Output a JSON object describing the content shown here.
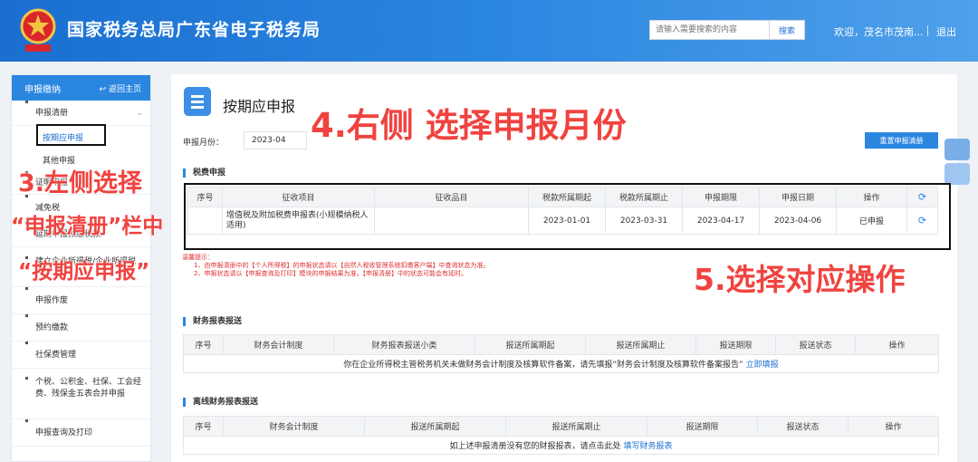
{
  "header": {
    "site_title": "国家税务总局广东省电子税务局",
    "search_placeholder": "请输入需要搜索的内容",
    "search_button": "搜索",
    "welcome": "欢迎，茂名市茂南...",
    "logout": "退出"
  },
  "sidebar": {
    "title": "申报缴纳",
    "back_home": "返回主页",
    "items": [
      {
        "label": "申报清册"
      },
      {
        "label": "按期应申报"
      },
      {
        "label": "其他申报"
      },
      {
        "label": "证明申报"
      },
      {
        "label": "减免税"
      },
      {
        "label": "延期申报预缴税款"
      },
      {
        "label": "建立企业所得税/企业所得税"
      },
      {
        "label": "申报作废"
      },
      {
        "label": "预约缴款"
      },
      {
        "label": "社保费管理"
      },
      {
        "label": "个税、公积金、社保、工会经费、残保金五表合并申报"
      },
      {
        "label": "申报查询及打印"
      }
    ]
  },
  "main": {
    "page_title": "按期应申报",
    "month_label": "申报月份：",
    "month_value": "2023-04",
    "reset_button": "重置申报清册",
    "tax_section": {
      "title": "税费申报",
      "headers": [
        "序号",
        "征收项目",
        "征收品目",
        "税款所属期起",
        "税款所属期止",
        "申报期限",
        "申报日期",
        "操作"
      ],
      "rows": [
        {
          "no": "",
          "item": "增值税及附加税费申报表(小规模纳税人适用)",
          "sub": "",
          "start": "2023-01-01",
          "end": "2023-03-31",
          "deadline": "2023-04-17",
          "date": "2023-04-06",
          "status": "已申报"
        }
      ]
    },
    "tips": {
      "lead": "温馨提示：",
      "line1": "1、由申报清册中的【个人所得税】的申报状态请以【自然人税收管理系统扣缴客户端】中查询状态为准。",
      "line2": "2、申报状态请以【申报查询及打印】模块的申报结果为准，【申报清册】中的状态可能会有延时。"
    },
    "fin_section": {
      "title": "财务报表报送",
      "headers": [
        "序号",
        "财务会计制度",
        "财务报表报送小类",
        "报送所属期起",
        "报送所属期止",
        "报送期限",
        "报送状态",
        "操作"
      ],
      "empty_text": "你在企业所得税主管税务机关未做财务会计制度及核算软件备案，请先填报“财务会计制度及核算软件备案报告”",
      "empty_link": "立即填报"
    },
    "offline_section": {
      "title": "离线财务报表报送",
      "headers": [
        "序号",
        "财务会计制度",
        "报送所属期起",
        "报送所属期止",
        "报送期限",
        "报送状态",
        "操作"
      ],
      "empty_text": "如上述申报清册没有您的财报报表，请点击此处",
      "empty_link": "填写财务报表"
    }
  },
  "annotations": {
    "step4": "4.右侧 选择申报月份",
    "step3_line1": "3.左侧选择",
    "step3_line2": "“申报清册”栏中",
    "step3_line3": "“按期应申报”",
    "step5": "5.选择对应操作"
  },
  "colors": {
    "header_blue": "#2b86e0",
    "annotation_red": "#f0433f",
    "link_blue": "#1a6fd0"
  }
}
